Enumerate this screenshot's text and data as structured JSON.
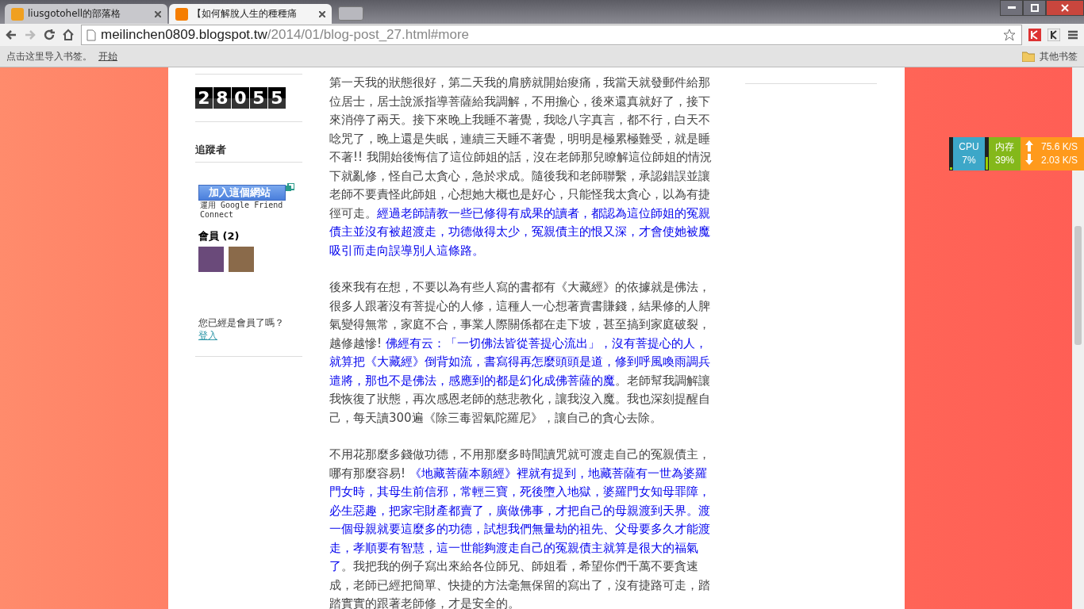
{
  "tabs": [
    {
      "title": "liusgotohell的部落格",
      "selected": false
    },
    {
      "title": "【如何解脫人生的種種痛",
      "selected": true
    }
  ],
  "address": {
    "host": "meilinchen0809.blogspot.tw",
    "path": "/2014/01/blog-post_27.html#more"
  },
  "bookmarks": {
    "import_text": "点击这里导入书签。",
    "start_link": "开始",
    "other": "其他书签"
  },
  "sidebar": {
    "counter": [
      "2",
      "8",
      "0",
      "5",
      "5"
    ],
    "followers_title": "追蹤者",
    "join_button": "加入這個網站",
    "gfc_note": "運用 Google Friend Connect",
    "members_title": "會員 (2)",
    "login_prompt": "您已經是會員了嗎？",
    "login_link": "登入"
  },
  "paragraphs": [
    [
      {
        "kind": "plain",
        "text": "第一天我的狀態很好，第二天我的肩膀就開始痠痛，我當天就發郵件給那位居士，居士說派指導菩薩給我調解，不用擔心，後來還真就好了，接下來消停了兩天。接下來晚上我睡不著覺，我唸八字真言，都不行，白天不唸咒了，晚上還是失眠，連續三天睡不著覺，明明是極累極難受，就是睡不著!! 我開始後悔信了這位師姐的話，沒在老師那兒瞭解這位師姐的情況下就亂修，怪自己太貪心，急於求成。隨後我和老師聯繫，承認錯誤並讓老師不要責怪此師姐，心想她大概也是好心，只能怪我太貪心，以為有捷徑可走。"
      },
      {
        "kind": "highlight",
        "text": "經過老師請教一些已修得有成果的讀者，都認為這位師姐的冤親債主並沒有被超渡走，功德做得太少，冤親債主的恨又深，才會使她被魔吸引而走向誤導別人這條路。"
      }
    ],
    [
      {
        "kind": "plain",
        "text": "後來我有在想，不要以為有些人寫的書都有《大藏經》的依據就是佛法，很多人跟著沒有菩提心的人修，這種人一心想著賣書賺錢，結果修的人脾氣變得無常，家庭不合，事業人際關係都在走下坡，甚至搞到家庭破裂，越修越慘! "
      },
      {
        "kind": "highlight",
        "text": "佛經有云：「一切佛法皆從菩提心流出」，沒有菩提心的人，就算把《大藏經》倒背如流，書寫得再怎麼頭頭是道，修到呼風喚雨調兵遣將，那也不是佛法，感應到的都是幻化成佛菩薩的魔"
      },
      {
        "kind": "plain",
        "text": "。老師幫我調解讓我恢復了狀態，再次感恩老師的慈悲教化，讓我沒入魔。我也深刻提醒自己，每天讀300遍《除三毒習氣陀羅尼》，讓自己的貪心去除。"
      }
    ],
    [
      {
        "kind": "plain",
        "text": "不用花那麼多錢做功德，不用那麼多時間讀咒就可渡走自己的冤親債主，哪有那麼容易! "
      },
      {
        "kind": "highlight",
        "text": "《地藏菩薩本願經》裡就有提到，地藏菩薩有一世為婆羅門女時，其母生前信邪，常輕三寶，死後墮入地獄，婆羅門女知母罪障，必生惡趣，把家宅財產都賣了，廣做佛事，才把自己的母親渡到天界。渡一個母親就要這麼多的功德，試想我們無量劫的祖先、父母要多久才能渡走，孝順要有智慧，這一世能夠渡走自己的冤親債主就算是很大的福氣了"
      },
      {
        "kind": "plain",
        "text": "。我把我的例子寫出來給各位師兄、師姐看，希望你們千萬不要貪速成，老師已經把簡單、快捷的方法毫無保留的寫出了，沒有捷路可走，踏踏實實的跟著老師修，才是安全的。"
      }
    ]
  ],
  "monitor": {
    "cpu": {
      "label": "CPU",
      "value": "7%",
      "level": 0.07
    },
    "memory": {
      "label": "内存",
      "value": "39%",
      "level": 0.39
    },
    "upload": "75.6 K/S",
    "download": "2.03 K/S"
  }
}
